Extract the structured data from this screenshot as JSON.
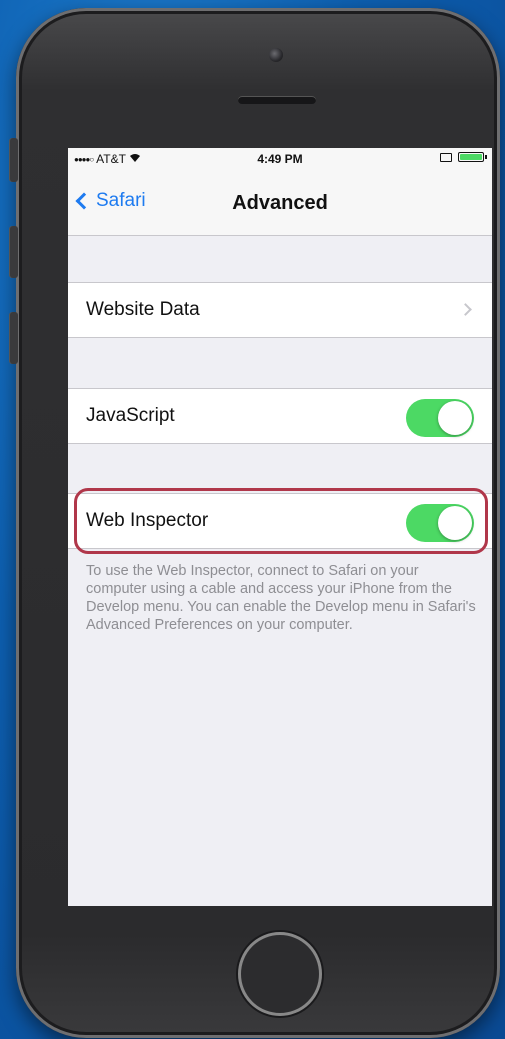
{
  "status_bar": {
    "signal": "●●●●○",
    "carrier": "AT&T",
    "wifi_icon": "wifi-icon",
    "time": "4:49 PM",
    "battery_color": "#4cd964"
  },
  "nav": {
    "back_label": "Safari",
    "title": "Advanced"
  },
  "settings": {
    "website_data_label": "Website Data",
    "javascript_label": "JavaScript",
    "javascript_enabled": true,
    "web_inspector_label": "Web Inspector",
    "web_inspector_enabled": true
  },
  "footer": {
    "text": "To use the Web Inspector, connect to Safari on your computer using a cable and access your iPhone from the Develop menu. You can enable the Develop menu in Safari's Advanced Preferences on your computer."
  },
  "colors": {
    "accent": "#1e7bf0",
    "toggle_on": "#4cd964",
    "highlight": "#b0374a"
  }
}
